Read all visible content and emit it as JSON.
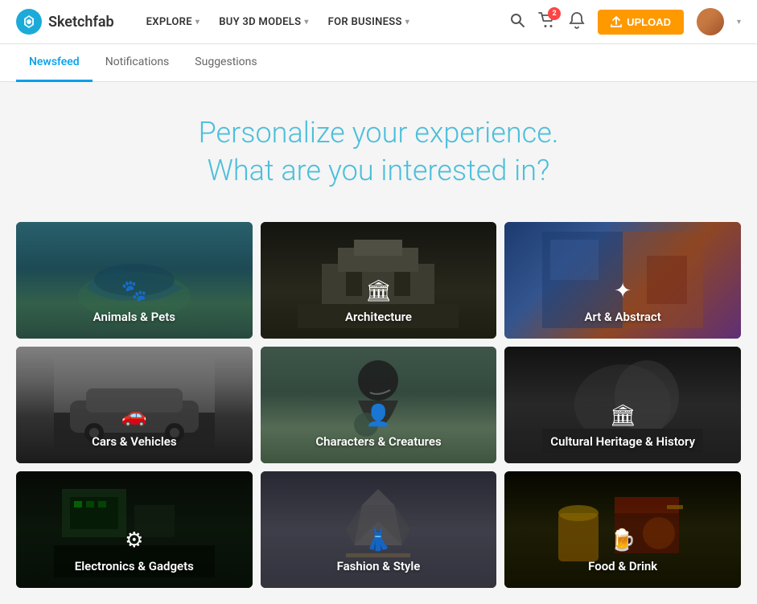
{
  "site": {
    "name": "Sketchfab"
  },
  "nav": {
    "explore_label": "EXPLORE",
    "buy3d_label": "BUY 3D MODELS",
    "forbusiness_label": "FOR BUSINESS",
    "upload_label": "UPLOAD",
    "cart_count": "2"
  },
  "subnav": {
    "tabs": [
      {
        "id": "newsfeed",
        "label": "Newsfeed",
        "active": true
      },
      {
        "id": "notifications",
        "label": "Notifications",
        "active": false
      },
      {
        "id": "suggestions",
        "label": "Suggestions",
        "active": false
      }
    ]
  },
  "headline": {
    "line1": "Personalize your experience.",
    "line2": "What are you interested in?"
  },
  "categories": [
    {
      "id": "animals",
      "label": "Animals & Pets",
      "icon": "🐾",
      "scene": "animals-scene"
    },
    {
      "id": "architecture",
      "label": "Architecture",
      "icon": "🏛",
      "scene": "architecture-scene"
    },
    {
      "id": "art",
      "label": "Art & Abstract",
      "icon": "✦",
      "scene": "art-scene"
    },
    {
      "id": "cars",
      "label": "Cars & Vehicles",
      "icon": "🚗",
      "scene": "cars-scene"
    },
    {
      "id": "characters",
      "label": "Characters & Creatures",
      "icon": "👤",
      "scene": "characters-scene"
    },
    {
      "id": "cultural",
      "label": "Cultural Heritage & History",
      "icon": "🏛",
      "scene": "cultural-scene"
    },
    {
      "id": "electronics",
      "label": "Electronics & Gadgets",
      "icon": "⚙",
      "scene": "electronics-scene"
    },
    {
      "id": "fashion",
      "label": "Fashion & Style",
      "icon": "👗",
      "scene": "fashion-scene"
    },
    {
      "id": "food",
      "label": "Food & Drink",
      "icon": "🍺",
      "scene": "food-scene"
    }
  ]
}
